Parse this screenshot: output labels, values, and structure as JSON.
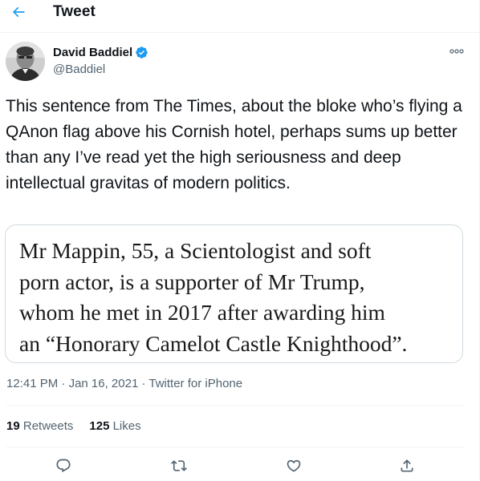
{
  "header": {
    "title": "Tweet",
    "back_icon": "arrow-left-icon"
  },
  "author": {
    "name": "David Baddiel",
    "handle": "@Baddiel",
    "verified_icon": "verified-badge-icon"
  },
  "tweet": {
    "text": "This sentence from The Times, about the bloke who’s flying a QAnon flag above his Cornish hotel, perhaps sums up better than any I’ve read yet the high seriousness and deep intellectual gravitas of modern politics.",
    "quoted_image_text": "Mr Mappin, 55, a Scientologist and soft\nporn actor, is a supporter of Mr Trump,\nwhom he met in 2017 after awarding him\nan “Honorary Camelot Castle Knighthood”."
  },
  "meta": {
    "time": "12:41 PM",
    "separator": "·",
    "date": "Jan 16, 2021",
    "source": "Twitter for iPhone"
  },
  "stats": {
    "retweets_count": "19",
    "retweets_label": "Retweets",
    "likes_count": "125",
    "likes_label": "Likes"
  },
  "actions": {
    "reply": "reply-icon",
    "retweet": "retweet-icon",
    "like": "like-icon",
    "share": "share-icon"
  },
  "colors": {
    "accent": "#1d9bf0",
    "text_primary": "#0f1419",
    "text_secondary": "#536471",
    "border": "#cfd9de"
  }
}
